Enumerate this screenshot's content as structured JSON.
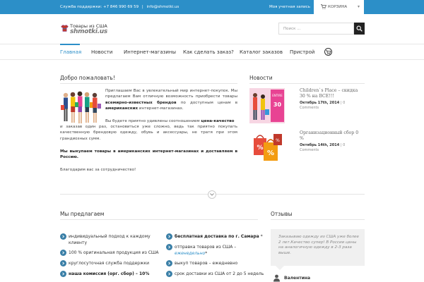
{
  "topbar": {
    "support_label": "Служба поддержки:",
    "phone": "+7 846 990 69 59",
    "email": "info@shmotki.us",
    "account": "Моя учетная запись",
    "cart_label": "КОРЗИНА"
  },
  "logo": {
    "line1": "Товары из США",
    "line2": "shmotki.us"
  },
  "search": {
    "placeholder": "Поиск ..."
  },
  "nav": {
    "items": [
      {
        "label": "Главная",
        "active": true
      },
      {
        "label": "Новости"
      },
      {
        "label": "Интернет-магазины"
      },
      {
        "label": "Как сделать заказ?"
      },
      {
        "label": "Каталог заказов"
      },
      {
        "label": "Пристрой"
      }
    ]
  },
  "welcome": {
    "title": "Добро пожаловать!",
    "p1_a": "Приглашаем Вас в увлекательный мир интернет-покупок. Мы предлагаем Вам отличную возможность приобрести товары ",
    "p1_b1": "всемирно-известных брендов",
    "p1_c": " по доступным ценам в ",
    "p1_b2": "американских",
    "p1_d": " интернет-магазинах.",
    "p2_a": "Вы будете приятно удивлены соотношением ",
    "p2_b": "цена-качество",
    "p2_c": " и заказав один раз, остановиться уже сложно, ведь так приятно покупать качественную брендовую одежду, обувь и аксессуары, не тратя при этом грандиозных сумм.",
    "p3": "Мы выкупаем товары в американских интернет-магазинах  и доставляем в Россию.",
    "p4": "Благодарим вас за сотрудничество!"
  },
  "news": {
    "title": "Новости",
    "items": [
      {
        "title": "Children`s Place – скидка 30 % на ВСЕ!!!",
        "date": "Октябрь 17th, 2014",
        "sep": " | ",
        "count": "0",
        "comments": "Comments"
      },
      {
        "title": "Организационный сбор 0 %",
        "date": "Октябрь 14th, 2014",
        "sep": " | ",
        "count": "0",
        "comments": "Comments"
      }
    ]
  },
  "offer": {
    "title": "Мы предлагаем",
    "left": [
      {
        "text": "индивидуальный подход к каждому клиенту"
      },
      {
        "text": "100 % оригинальная продукция из США"
      },
      {
        "text": "круглосуточная служба поддержки"
      },
      {
        "text": "наша комиссия (орг. сбор) – 10%"
      }
    ],
    "right_1_a": "бесплатная доставка по г. Самара",
    "right_1_b": " *",
    "right_2_a": "отправка товаров из США – ",
    "right_2_b": "еженедельно",
    "right_2_c": "*",
    "right_3": "выкуп товаров – ежедневно",
    "right_4": "срок доставки из США от 2 до 5 недель"
  },
  "reviews": {
    "title": "Отзывы",
    "text": "Заказываю одежду из США уже более 2 лет.Качество супер! В России цены на аналогичную одежду в 2-3 раза выше.",
    "author": "Валентина"
  }
}
